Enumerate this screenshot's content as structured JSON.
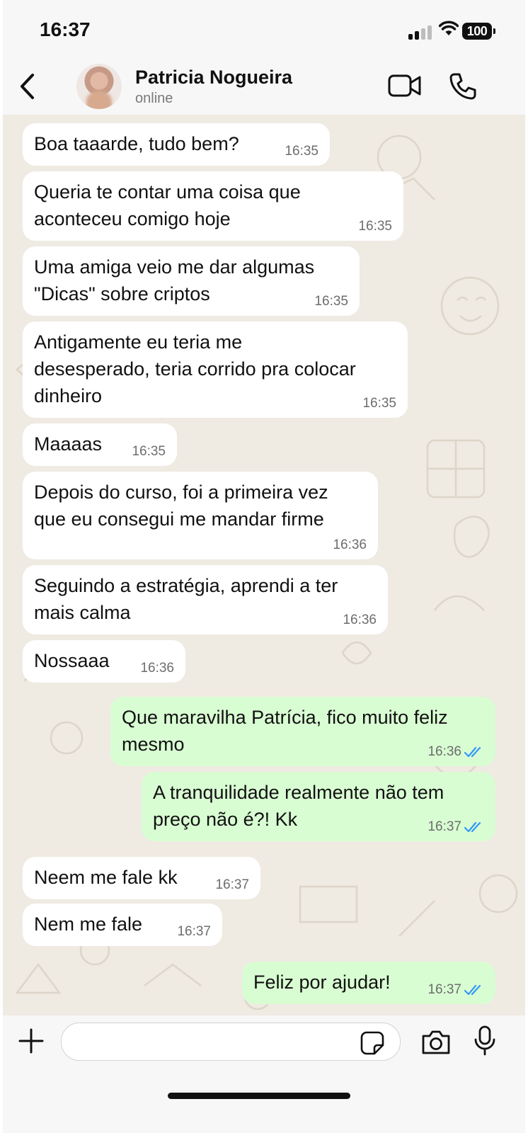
{
  "status_bar": {
    "time": "16:37",
    "battery": "100"
  },
  "header": {
    "contact_name": "Patricia Nogueira",
    "contact_status": "online"
  },
  "colors": {
    "incoming": "#ffffff",
    "outgoing": "#d9fdd3",
    "tick_read": "#3497f9",
    "chat_bg": "#efeae2"
  },
  "messages": [
    {
      "dir": "in",
      "lines": [
        "Boa taaarde, tudo bem?"
      ],
      "time": "16:35"
    },
    {
      "dir": "in",
      "lines": [
        "Queria te contar uma coisa que",
        "aconteceu comigo hoje"
      ],
      "time": "16:35"
    },
    {
      "dir": "in",
      "lines": [
        "Uma amiga veio me dar algumas",
        "\"Dicas\" sobre criptos"
      ],
      "time": "16:35"
    },
    {
      "dir": "in",
      "lines": [
        "Antigamente eu teria me",
        "desesperado, teria corrido pra colocar",
        "dinheiro"
      ],
      "time": "16:35"
    },
    {
      "dir": "in",
      "lines": [
        "Maaaas"
      ],
      "time": "16:35"
    },
    {
      "dir": "in",
      "lines": [
        "Depois do curso, foi a primeira vez",
        "que eu consegui me mandar firme"
      ],
      "time": "16:36"
    },
    {
      "dir": "in",
      "lines": [
        "Seguindo a estratégia, aprendi a ter",
        "mais calma"
      ],
      "time": "16:36"
    },
    {
      "dir": "in",
      "lines": [
        "Nossaaa"
      ],
      "time": "16:36"
    },
    {
      "dir": "out",
      "lines": [
        "Que maravilha Patrícia, fico muito feliz",
        "mesmo"
      ],
      "time": "16:36",
      "status": "read"
    },
    {
      "dir": "out",
      "lines": [
        "A tranquilidade realmente não tem",
        "preço não é?! Kk"
      ],
      "time": "16:37",
      "status": "read"
    },
    {
      "dir": "in",
      "lines": [
        "Neem me fale kk"
      ],
      "time": "16:37"
    },
    {
      "dir": "in",
      "lines": [
        "Nem me fale"
      ],
      "time": "16:37"
    },
    {
      "dir": "out",
      "lines": [
        "Feliz por ajudar!"
      ],
      "time": "16:37",
      "status": "read"
    }
  ],
  "input": {
    "placeholder": ""
  },
  "icons": {
    "back": "chevron-left-icon",
    "video": "video-camera-icon",
    "call": "phone-icon",
    "add": "plus-icon",
    "sticker": "sticker-icon",
    "camera": "camera-icon",
    "mic": "microphone-icon"
  }
}
